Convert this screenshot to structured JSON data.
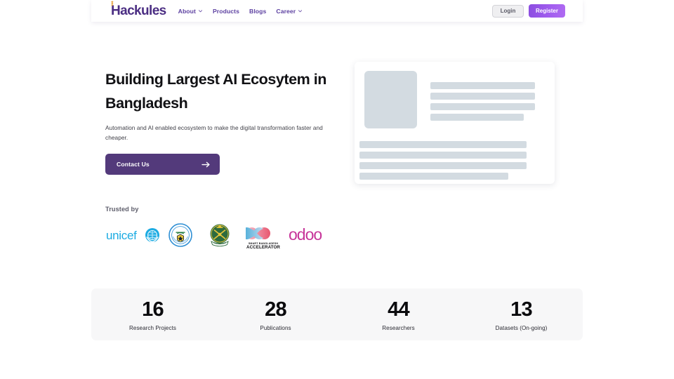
{
  "header": {
    "logo_text": "Hackules",
    "logo_icon": "hackules-logo-mark",
    "nav": [
      {
        "label": "About",
        "has_dropdown": true,
        "icon": "chevron-down-icon"
      },
      {
        "label": "Products",
        "has_dropdown": false,
        "icon": ""
      },
      {
        "label": "Blogs",
        "has_dropdown": false,
        "icon": ""
      },
      {
        "label": "Career",
        "has_dropdown": true,
        "icon": "chevron-down-icon"
      }
    ],
    "login_label": "Login",
    "register_label": "Register"
  },
  "hero": {
    "title": "Building Largest AI Ecosytem in Bangladesh",
    "subtitle": "Automation and AI enabled ecosystem to make the digital transformation faster and cheaper.",
    "cta_label": "Contact Us",
    "cta_icon": "arrow-right-icon"
  },
  "skeleton": {
    "name": "content-placeholder-card"
  },
  "trusted": {
    "label": "Trusted by",
    "logos": [
      {
        "name": "unicef-logo",
        "alt": "unicef"
      },
      {
        "name": "university-seal-logo",
        "alt": "University Seal"
      },
      {
        "name": "bangladesh-army-emblem-logo",
        "alt": "Bangladesh Army Emblem"
      },
      {
        "name": "smart-bangladesh-accelerator-logo",
        "alt": "SMART BANGLADESH ACCELERATOR"
      },
      {
        "name": "odoo-logo",
        "alt": "odoo"
      }
    ],
    "smart_line1": "SMART BANGLADESH",
    "smart_line2": "ACCELERATOR",
    "odoo_text": "odoo",
    "unicef_text": "unicef"
  },
  "stats": [
    {
      "value": "16",
      "label": "Research Projects"
    },
    {
      "value": "28",
      "label": "Publications"
    },
    {
      "value": "44",
      "label": "Researchers"
    },
    {
      "value": "13",
      "label": "Datasets (On-going)"
    }
  ],
  "colors": {
    "brand_purple": "#4B2E83",
    "nav_purple": "#5B3FA0",
    "register_purple": "#A05CEE",
    "contact_purple": "#533A7B",
    "skeleton_gray": "#D3DBE1",
    "stats_bg": "#F7F7F8",
    "unicef_cyan": "#1CABE2",
    "odoo_magenta": "#C7359A",
    "army_green": "#2E6B3E"
  }
}
